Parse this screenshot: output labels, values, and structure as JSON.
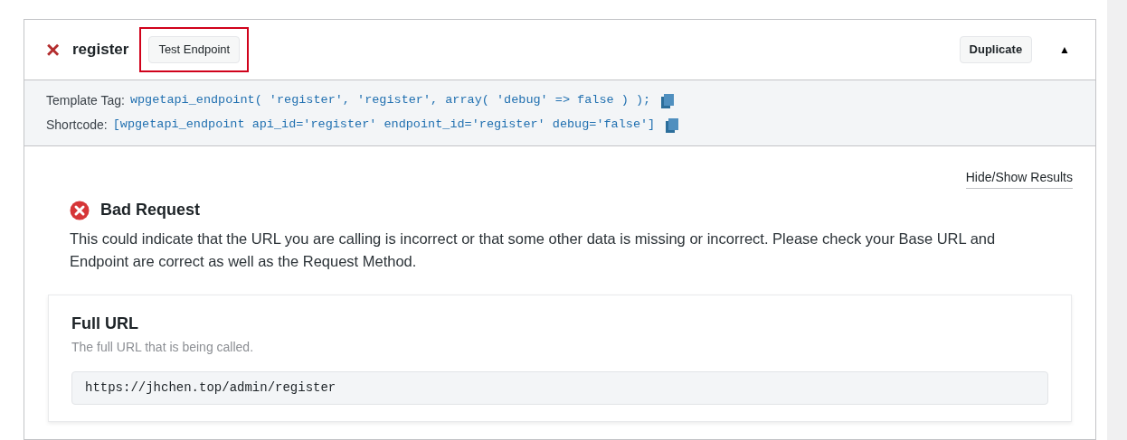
{
  "endpoint": {
    "close": "×",
    "name": "register",
    "test_button": {
      "label": "Test Endpoint",
      "highlighted": true
    },
    "duplicate_button": "Duplicate",
    "toggle": "▲",
    "expanded": true
  },
  "tags": [
    {
      "label": "Template Tag:",
      "code": "wpgetapi_endpoint( 'register', 'register', array( 'debug' => false ) );"
    },
    {
      "label": "Shortcode:",
      "code": "[wpgetapi_endpoint api_id='register' endpoint_id='register' debug='false']"
    }
  ],
  "results_link": "Hide/Show Results",
  "error": {
    "title": "Bad Request",
    "message": "This could indicate that the URL you are calling is incorrect or that some other data is missing or incorrect. Please check your Base URL and Endpoint are correct as well as the Request Method."
  },
  "full_url": {
    "title": "Full URL",
    "description": "The full URL that is being called.",
    "value": "https://jhchen.top/admin/register"
  }
}
